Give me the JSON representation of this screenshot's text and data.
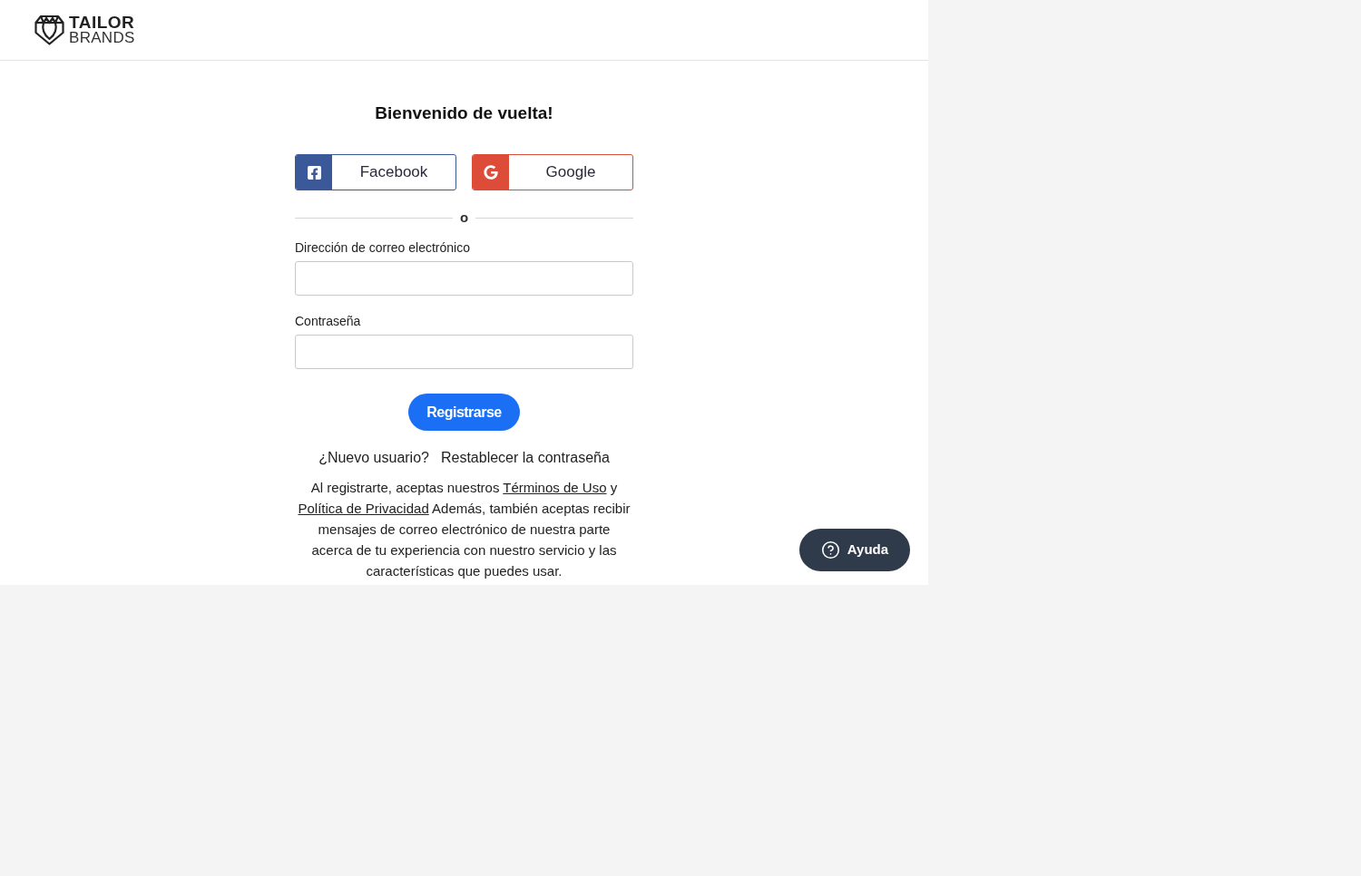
{
  "header": {
    "logo": {
      "line_1": "TAILOR",
      "line_2": "BRANDS"
    }
  },
  "login": {
    "title": "Bienvenido de vuelta!",
    "social_buttons": [
      {
        "kind": "facebook",
        "label": "Facebook",
        "color": "#3b5998"
      },
      {
        "kind": "google",
        "label": "Google",
        "color": "#dd4b39"
      }
    ],
    "divider_text": "o",
    "fields": [
      {
        "label": "Dirección de correo electrónico"
      },
      {
        "label": "Contraseña"
      }
    ],
    "submit": "Registrarse",
    "links": [
      "¿Nuevo usuario?",
      "Restablecer la contraseña"
    ],
    "legal": [
      {
        "kind": "text",
        "text": "Al registrarte, aceptas nuestros "
      },
      {
        "kind": "link",
        "text": "Términos de Uso"
      },
      {
        "kind": "text",
        "text": " y "
      },
      {
        "kind": "link",
        "text": "Política de Privacidad"
      },
      {
        "kind": "text",
        "text": " Además, también aceptas recibir mensajes de correo electrónico de nuestra parte acerca de tu experiencia con nuestro servicio y las características que puedes usar."
      }
    ]
  },
  "help_button": {
    "label": "Ayuda"
  }
}
